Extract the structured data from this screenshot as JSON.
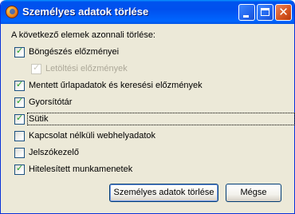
{
  "window": {
    "title": "Személyes adatok törlése",
    "controls": {
      "minimize": "minimize",
      "maximize": "maximize",
      "close": "✕"
    }
  },
  "dialog": {
    "heading": "A következő elemek azonnali törlése:",
    "items": [
      {
        "label": "Böngészés előzményei",
        "checked": true,
        "disabled": false,
        "indent": false
      },
      {
        "label": "Letöltési előzmények",
        "checked": true,
        "disabled": true,
        "indent": true
      },
      {
        "label": "Mentett űrlapadatok és keresési előzmények",
        "checked": true,
        "disabled": false,
        "indent": false
      },
      {
        "label": "Gyorsítótár",
        "checked": true,
        "disabled": false,
        "indent": false
      },
      {
        "label": "Sütik",
        "checked": true,
        "disabled": false,
        "indent": false,
        "focused": true
      },
      {
        "label": "Kapcsolat nélküli webhelyadatok",
        "checked": false,
        "disabled": false,
        "indent": false
      },
      {
        "label": "Jelszókezelő",
        "checked": false,
        "disabled": false,
        "indent": false
      },
      {
        "label": "Hitelesített munkamenetek",
        "checked": true,
        "disabled": false,
        "indent": false
      }
    ],
    "buttons": {
      "confirm": "Személyes adatok törlése",
      "cancel": "Mégse"
    }
  },
  "colors": {
    "titlebar": "#0054E3",
    "face": "#ECE9D8",
    "checkmark": "#21A121",
    "checkbox_border": "#1C5180"
  }
}
